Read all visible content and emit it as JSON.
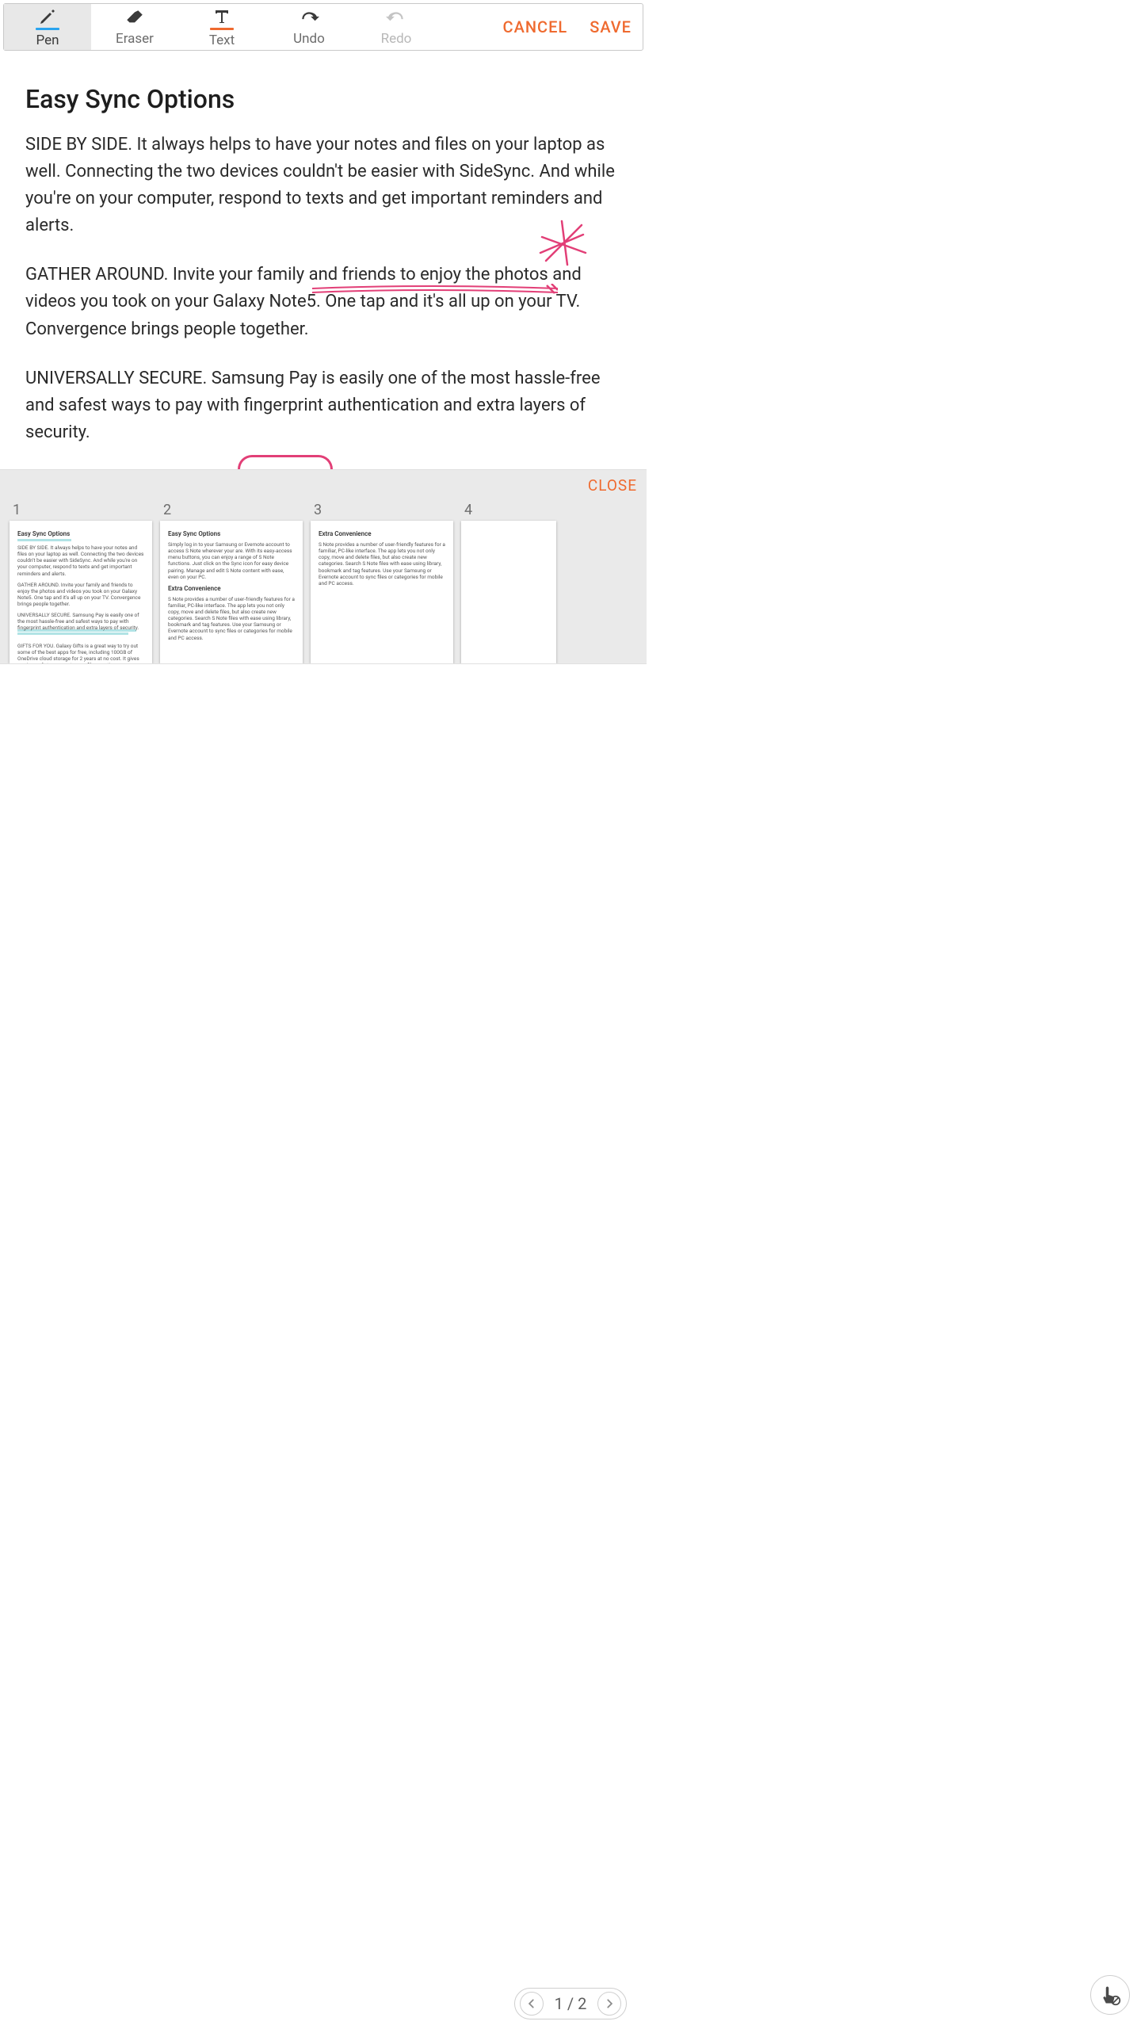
{
  "toolbar": {
    "pen": "Pen",
    "eraser": "Eraser",
    "text": "Text",
    "undo": "Undo",
    "redo": "Redo",
    "cancel": "CANCEL",
    "save": "SAVE"
  },
  "doc": {
    "title": "Easy Sync Options",
    "p1": "SIDE BY SIDE. It always helps to have your notes and files on your laptop as well. Connecting the two devices couldn't be easier with SideSync. And while you're on your computer, respond to texts and get important reminders and alerts.",
    "p2": "GATHER AROUND. Invite your family and friends to enjoy the photos and videos you took on your Galaxy Note5. One tap and it's all up on your TV. Convergence brings people together.",
    "p3": "UNIVERSALLY SECURE. Samsung Pay is easily one of the most hassle-free and safest ways to pay with fingerprint authentication and extra layers of security."
  },
  "strip": {
    "close": "CLOSE",
    "nums": [
      "1",
      "2",
      "3",
      "4"
    ],
    "t1": {
      "h": "Easy Sync Options",
      "a": "SIDE BY SIDE. It always helps to have your notes and files on your laptop as well. Connecting the two devices couldn't be easier with SideSync. And while you're on your computer, respond to texts and get important reminders and alerts.",
      "b": "GATHER AROUND. Invite your family and friends to enjoy the photos and videos you took on your Galaxy Note5. One tap and it's all up on your TV. Convergence brings people together.",
      "c": "UNIVERSALLY SECURE. Samsung Pay is easily one of the most hassle-free and safest ways to pay with fingerprint authentication and extra layers of security.",
      "d": "GIFTS FOR YOU. Galaxy Gifts is a great way to try out some of the best apps for free, including 100GB of OneDrive cloud storage for 2 years at no cost. It gives you immediate access to your files any time."
    },
    "t2": {
      "h": "Easy Sync Options",
      "a": "Simply log in to your Samsung or Evernote account to access S Note wherever your are. With its easy-access menu buttons, you can enjoy a range of S Note functions. Just click on the Sync icon for easy device pairing. Manage and edit S Note content with ease, even on your PC.",
      "h2": "Extra Convenience",
      "b": "S Note provides a number of user-friendly features for a familiar, PC-like interface. The app lets you not only copy, move and delete files, but also create new categories. Search S Note files with ease using library, bookmark and tag features. Use your Samsung or Evernote account to sync files or categories for mobile and PC access."
    },
    "t3": {
      "h": "Extra Convenience",
      "a": "S Note provides a number of user-friendly features for a familiar, PC-like interface. The app lets you not only copy, move and delete files, but also create new categories. Search S Note files with ease using library, bookmark and tag features. Use your Samsung or Evernote account to sync files or categories for mobile and PC access."
    }
  },
  "pager": {
    "label": "1 / 2"
  },
  "colors": {
    "accent": "#ef6a2f",
    "highlight": "#b1e3e5",
    "ink": "#e23f77"
  }
}
